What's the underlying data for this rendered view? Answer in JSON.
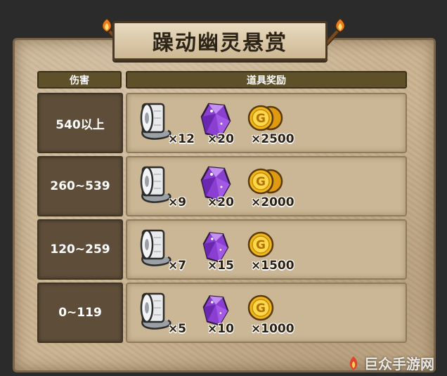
{
  "title": "躁动幽灵悬赏",
  "headers": {
    "damage": "伤害",
    "rewards": "道具奖励"
  },
  "items": {
    "paper": "paper-roll-icon",
    "crystal": "purple-crystal-icon",
    "gold": "gold-coin-icon"
  },
  "rows": [
    {
      "damage": "540以上",
      "paper": "×12",
      "crystal": "×20",
      "gold": "×2500"
    },
    {
      "damage": "260~539",
      "paper": "×9",
      "crystal": "×20",
      "gold": "×2000"
    },
    {
      "damage": "120~259",
      "paper": "×7",
      "crystal": "×15",
      "gold": "×1500"
    },
    {
      "damage": "0~119",
      "paper": "×5",
      "crystal": "×10",
      "gold": "×1000"
    }
  ],
  "watermark": "巨众手游网",
  "colors": {
    "board": "#c9b290",
    "damage_cell": "#5e4e39",
    "header": "#5e5029",
    "crystal": "#8a3fd1",
    "gold": "#f2b81a"
  }
}
